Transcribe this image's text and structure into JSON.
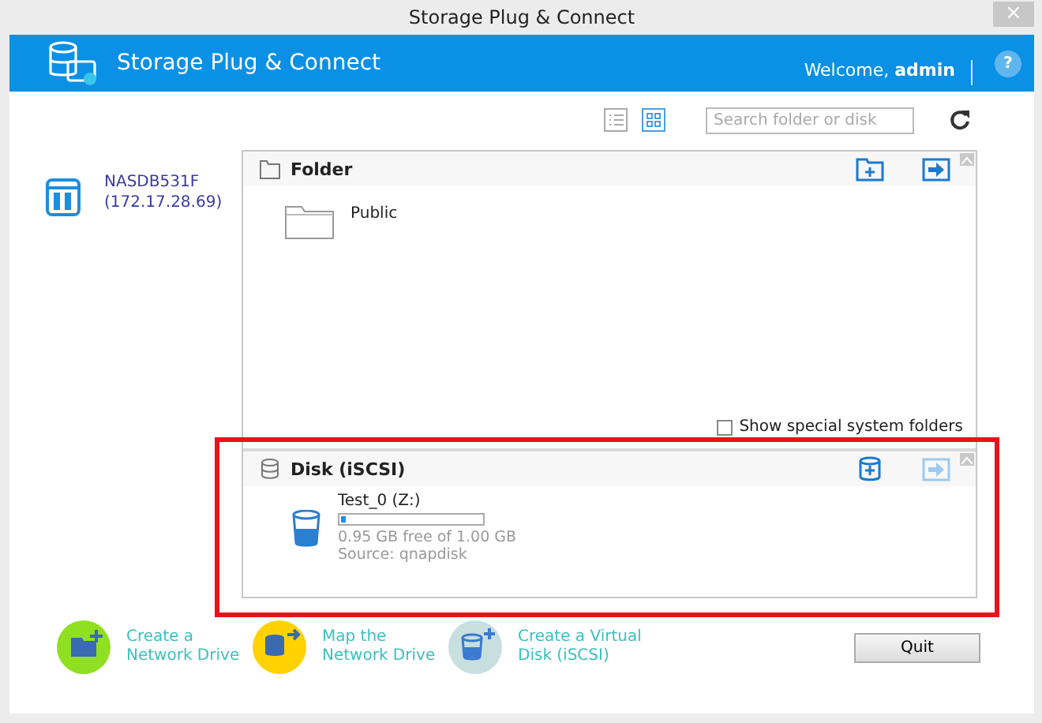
{
  "window": {
    "title": "Storage Plug & Connect",
    "close": "×"
  },
  "header": {
    "title": "Storage Plug & Connect",
    "welcome": "Welcome, ",
    "user": "admin",
    "help": "?"
  },
  "toolbar": {
    "views": [
      {
        "kind": "list",
        "selected": false
      },
      {
        "kind": "grid",
        "selected": true
      }
    ],
    "search": {
      "placeholder": "Search folder or disk"
    }
  },
  "nas": {
    "name": "NASDB531F",
    "address": "(172.17.28.69)"
  },
  "folder_section": {
    "title": "Folder",
    "items": [
      {
        "name": "Public"
      }
    ],
    "show_special": {
      "label": "Show special system folders",
      "checked": false
    }
  },
  "disk_section": {
    "title": "Disk (iSCSI)",
    "highlighted": true,
    "disks": [
      {
        "name": "Test_0 (Z:)",
        "level": 0.03,
        "free": "0.95 GB free of 1.00 GB",
        "source": "Source: qnapdisk"
      }
    ]
  },
  "actions": [
    {
      "kind": "create",
      "color": "#8fe020",
      "lines": [
        "Create a",
        "Network Drive"
      ]
    },
    {
      "kind": "map",
      "color": "#ffd200",
      "lines": [
        "Map the",
        "Network Drive"
      ]
    },
    {
      "kind": "virtual",
      "color": "#c8dfe0",
      "lines": [
        "Create a Virtual",
        "Disk (iSCSI)"
      ]
    }
  ],
  "quit": "Quit"
}
